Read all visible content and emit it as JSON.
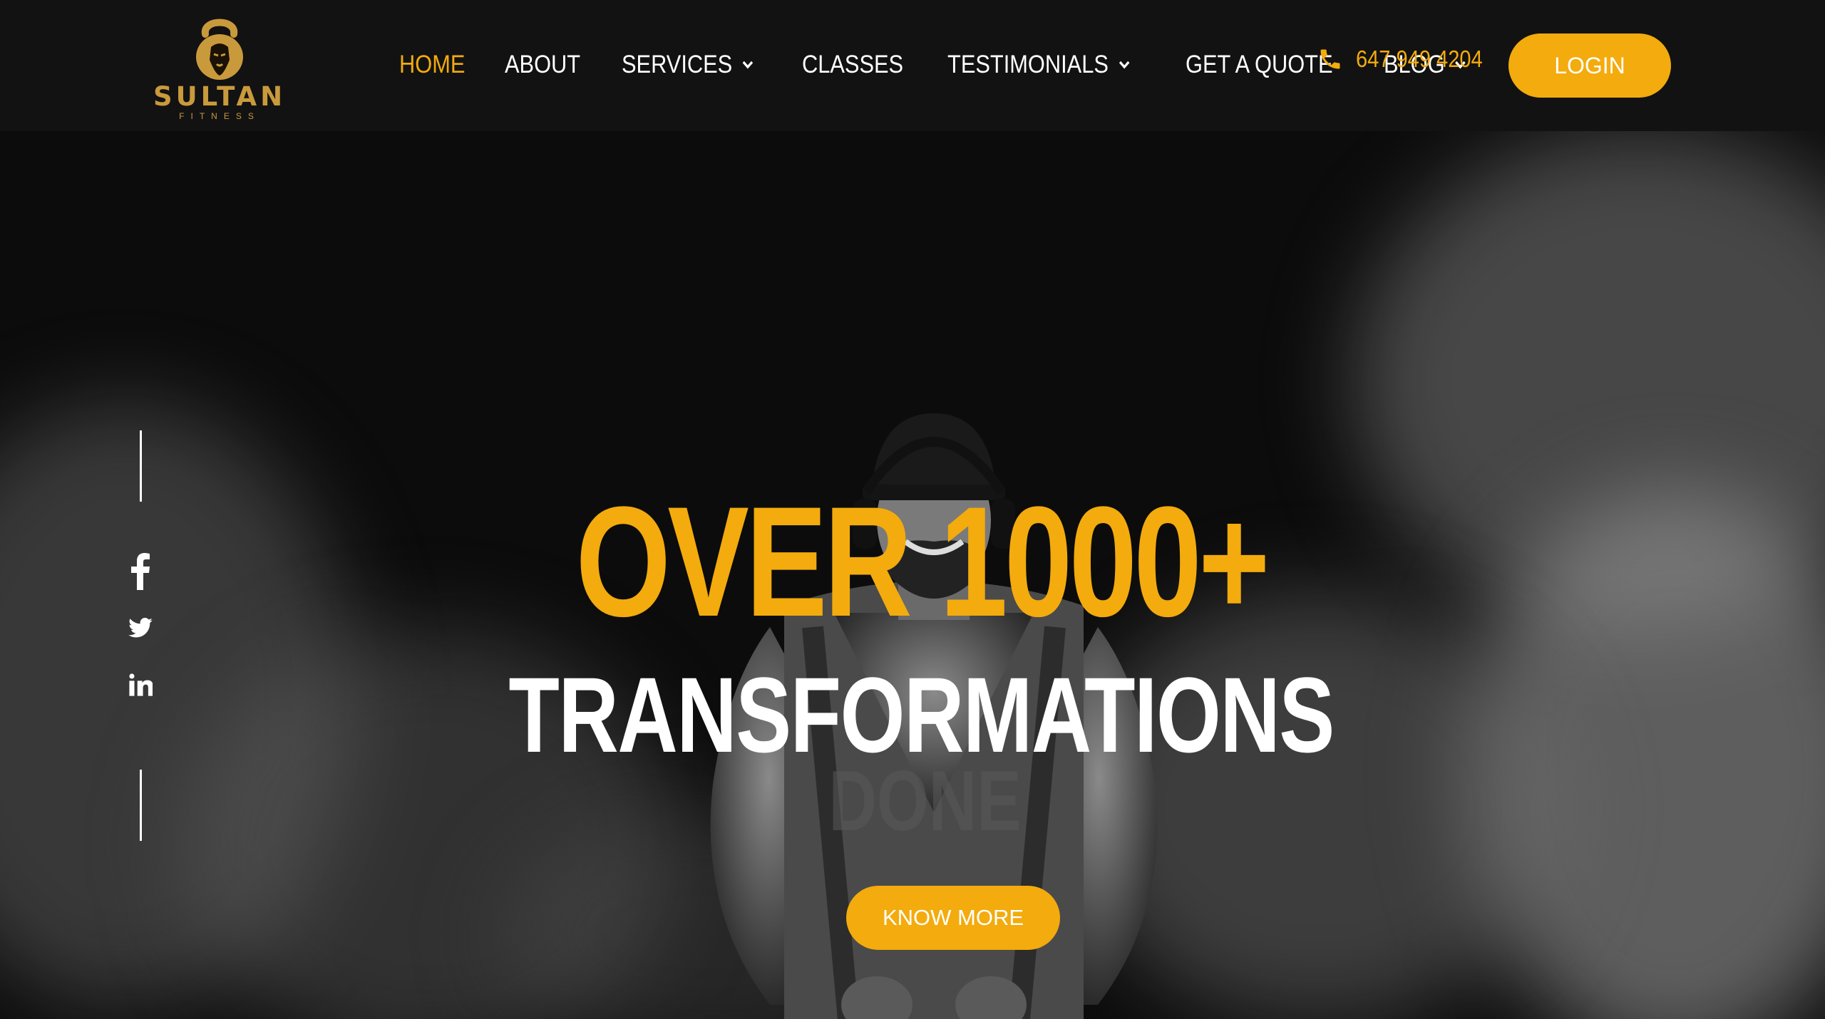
{
  "brand": {
    "name": "SULTAN",
    "tagline": "FITNESS",
    "icon": "kettlebell-lion-logo",
    "color": "#c99a3c"
  },
  "colors": {
    "accent": "#f3ab0d",
    "background": "#0c0c0c",
    "header": "#121212",
    "text": "#ffffff"
  },
  "nav": {
    "items": [
      {
        "label": "HOME",
        "active": true,
        "has_dropdown": false
      },
      {
        "label": "ABOUT",
        "active": false,
        "has_dropdown": false
      },
      {
        "label": "SERVICES",
        "active": false,
        "has_dropdown": true
      },
      {
        "label": "CLASSES",
        "active": false,
        "has_dropdown": false
      },
      {
        "label": "TESTIMONIALS",
        "active": false,
        "has_dropdown": true
      },
      {
        "label": "GET A QUOTE",
        "active": false,
        "has_dropdown": false
      },
      {
        "label": "BLOG",
        "active": false,
        "has_dropdown": true
      }
    ],
    "dropdown_icon": "chevron-down-icon"
  },
  "contact": {
    "phone": "647 949 4204",
    "icon": "phone-icon"
  },
  "header": {
    "login_label": "LOGIN"
  },
  "social": {
    "icons": [
      "facebook-icon",
      "twitter-icon",
      "linkedin-icon"
    ]
  },
  "hero": {
    "headline_primary": "OVER 1000+",
    "headline_secondary": "TRANSFORMATIONS",
    "headline_tertiary": "DONE",
    "cta_label": "KNOW MORE"
  }
}
